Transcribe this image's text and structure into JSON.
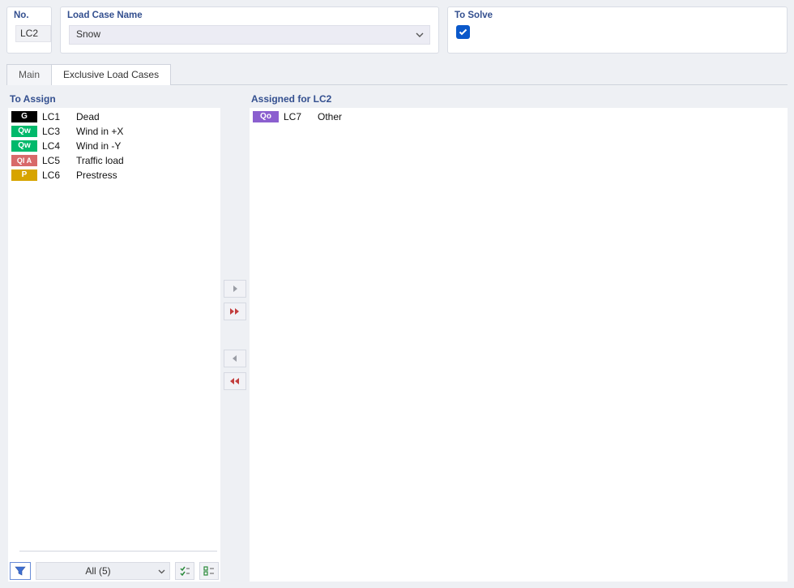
{
  "header": {
    "no_label": "No.",
    "no_value": "LC2",
    "name_label": "Load Case Name",
    "name_value": "Snow",
    "solve_label": "To Solve",
    "solve_checked": true
  },
  "tabs": {
    "main": "Main",
    "exclusive": "Exclusive Load Cases"
  },
  "left": {
    "title": "To Assign",
    "items": [
      {
        "tag": "G",
        "tagClass": "tag-G",
        "id": "LC1",
        "desc": "Dead"
      },
      {
        "tag": "Qw",
        "tagClass": "tag-Qw",
        "id": "LC3",
        "desc": "Wind in +X"
      },
      {
        "tag": "Qw",
        "tagClass": "tag-Qw",
        "id": "LC4",
        "desc": "Wind in -Y"
      },
      {
        "tag": "QI A",
        "tagClass": "tag-QIA",
        "id": "LC5",
        "desc": "Traffic load"
      },
      {
        "tag": "P",
        "tagClass": "tag-P",
        "id": "LC6",
        "desc": "Prestress"
      }
    ],
    "filter_all": "All (5)"
  },
  "right": {
    "title": "Assigned for LC2",
    "items": [
      {
        "tag": "Qo",
        "tagClass": "tag-Qo",
        "id": "LC7",
        "desc": "Other"
      }
    ]
  }
}
